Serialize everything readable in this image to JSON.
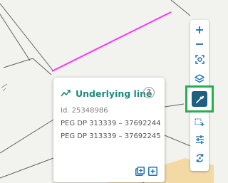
{
  "popup": {
    "title": "Underlying line",
    "title_icon": "trend-line-icon",
    "help_symbol": "?",
    "id_text": "Id. 25348986",
    "references": [
      "PEG DP 313339 – 37692244",
      "PEG DP 313339 – 37692245"
    ],
    "actions": [
      "copy-to-clipboard-icon",
      "add-to-selection-icon"
    ],
    "accent_color": "#1e8a7c"
  },
  "toolbar": {
    "buttons": [
      {
        "name": "zoom-in-button",
        "icon": "plus-icon"
      },
      {
        "name": "zoom-out-button",
        "icon": "minus-icon"
      },
      {
        "name": "locate-button",
        "icon": "crosshair-target-icon"
      },
      {
        "name": "layers-button",
        "icon": "layers-icon"
      },
      {
        "name": "identify-tool-button",
        "icon": "eyedropper-icon",
        "active": true
      },
      {
        "name": "add-point-button",
        "icon": "dotted-add-icon"
      },
      {
        "name": "settings-button",
        "icon": "sliders-icon"
      },
      {
        "name": "rotate-button",
        "icon": "rotate-refresh-icon"
      }
    ],
    "icon_color": "#1f6fb5",
    "active_background": "#1f5f7f",
    "highlight_color": "#22b14c"
  },
  "map": {
    "background": "#f2f2ee",
    "parcel_line_color": "#606060",
    "highlight_line_color": "#ff33ff",
    "sand_area_color": "#f3d9a4"
  }
}
